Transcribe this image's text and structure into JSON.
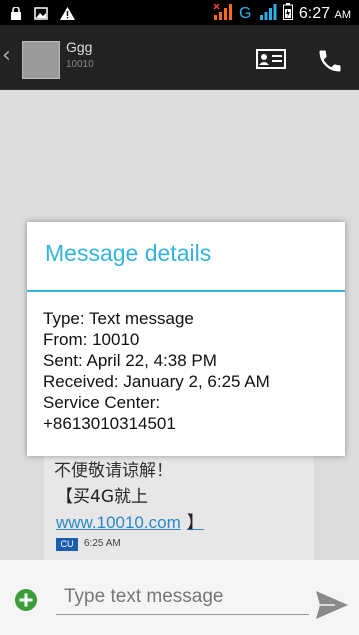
{
  "status_bar": {
    "time": "6:27",
    "ampm": "AM"
  },
  "conversation": {
    "contact_name": "Ggg",
    "contact_number": "10010"
  },
  "message": {
    "line1": "不便敬请谅解！",
    "line2": "【买4G就上",
    "link": "www.10010.com",
    "link_suffix": "】",
    "sim_label": "CU",
    "time": "6:25 AM"
  },
  "dialog": {
    "title": "Message details",
    "lines": [
      "Type: Text message",
      "From: 10010",
      "Sent: April 22, 4:38 PM",
      "Received: January 2, 6:25 AM",
      "Service Center:",
      "+8613010314501"
    ]
  },
  "composer": {
    "placeholder": "Type text message"
  }
}
